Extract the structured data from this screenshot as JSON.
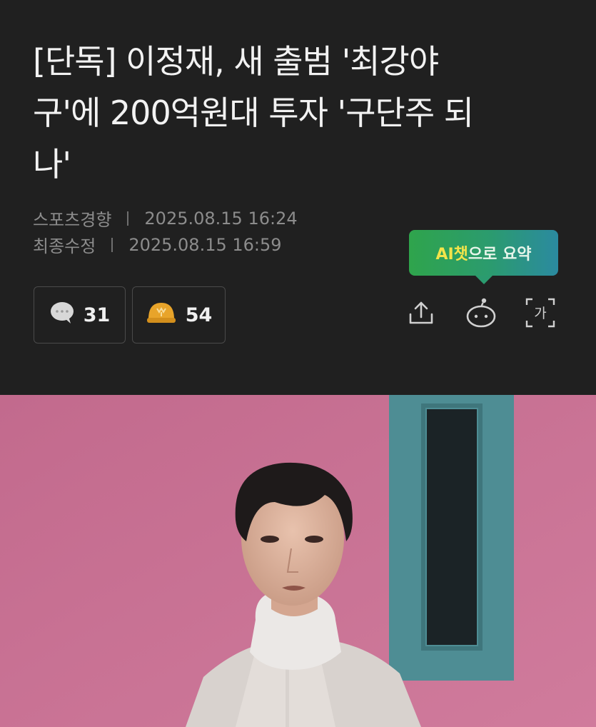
{
  "article": {
    "title_lines": [
      "[단독] 이정재, 새 출범 '최강야",
      "구'에 200억원대 투자 '구단주 되",
      "나'"
    ],
    "source": "스포츠경향",
    "published": "2025.08.15 16:24",
    "modified_label": "최종수정",
    "modified": "2025.08.15 16:59"
  },
  "actions": {
    "comments_count": "31",
    "reactions_count": "54",
    "ai_tooltip_prefix": "AI챗",
    "ai_tooltip_suffix": "으로 요약",
    "icons": [
      "share-icon",
      "ai-chat-bot-icon",
      "font-size-icon"
    ],
    "font_size_glyph": "가"
  },
  "colors": {
    "background": "#202020",
    "tooltip_green": "#2fa44c",
    "tooltip_teal": "#2b8aa0",
    "highlight_yellow": "#f3e44a",
    "photo_pink": "#c86f91",
    "photo_teal_frame": "#4e8d94"
  }
}
